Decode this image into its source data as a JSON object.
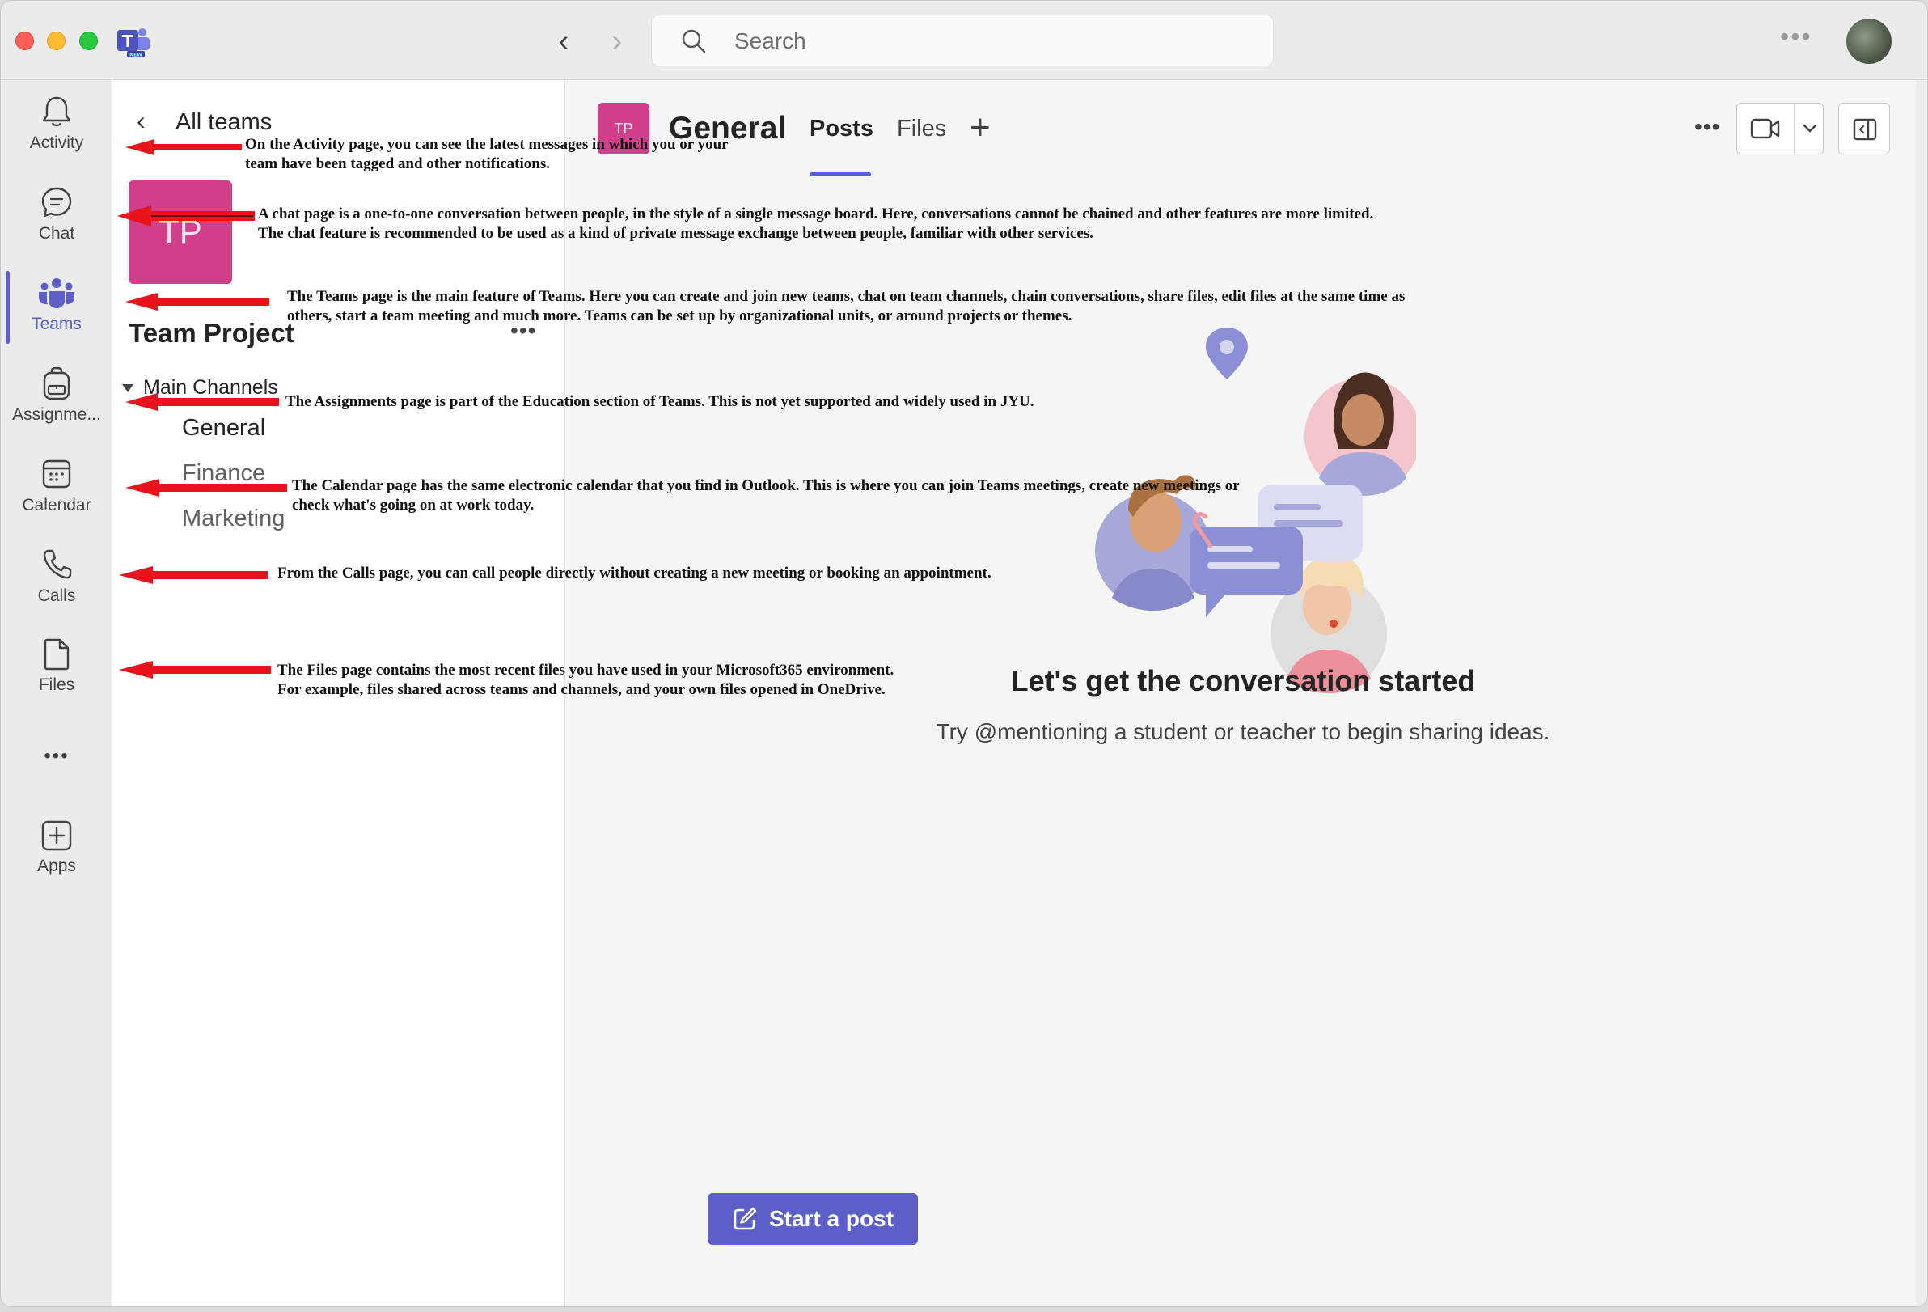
{
  "search": {
    "placeholder": "Search"
  },
  "rail": {
    "items": [
      {
        "label": "Activity",
        "icon": "bell-icon"
      },
      {
        "label": "Chat",
        "icon": "chat-icon"
      },
      {
        "label": "Teams",
        "icon": "teams-icon",
        "active": true
      },
      {
        "label": "Assignme...",
        "icon": "backpack-icon"
      },
      {
        "label": "Calendar",
        "icon": "calendar-icon"
      },
      {
        "label": "Calls",
        "icon": "phone-icon"
      },
      {
        "label": "Files",
        "icon": "file-icon"
      },
      {
        "label": "Apps",
        "icon": "add-app-icon"
      }
    ],
    "more": "•••"
  },
  "team_pane": {
    "back_label": "All teams",
    "team_initials": "TP",
    "team_name": "Team Project",
    "team_more": "•••",
    "section_label": "Main Channels",
    "channels": [
      "General",
      "Finance",
      "Marketing"
    ]
  },
  "channel_header": {
    "initials": "TP",
    "title": "General",
    "tabs": [
      "Posts",
      "Files"
    ],
    "add_tab": "+",
    "more": "•••"
  },
  "empty_state": {
    "title": "Let's get the conversation started",
    "subtitle": "Try @mentioning a student or teacher to begin sharing ideas."
  },
  "start_post": {
    "label": "Start a post"
  },
  "annotations": [
    "On the Activity page, you can see the latest messages in which you or your team have been tagged and other notifications.",
    "A chat page is a one-to-one conversation between people, in the style of a single message board. Here, conversations cannot be chained and other features are more limited. The chat feature is recommended to be used as a kind of private message exchange between people, familiar with other services.",
    "The Teams page is the main feature of Teams. Here you can create and join new teams, chat on team channels, chain conversations, share files, edit files at the same time as others, start a team meeting and much more. Teams can be set up by organizational units, or around projects or themes.",
    "The Assignments page is part of the Education section of Teams. This is not yet supported and widely used in JYU.",
    "The Calendar page has the same electronic calendar that you find in Outlook. This is where you can join Teams meetings, create new meetings or check what's going on at work today.",
    "From the Calls page, you can call people directly without creating a new meeting or booking an appointment.",
    "The Files page contains the most recent files you have used in your Microsoft365 environment. For example, files shared across teams and channels, and your own files opened in OneDrive."
  ],
  "colors": {
    "accent": "#5b5fc7",
    "team_tile": "#d13f8a",
    "annotation_arrow": "#e8141c"
  }
}
